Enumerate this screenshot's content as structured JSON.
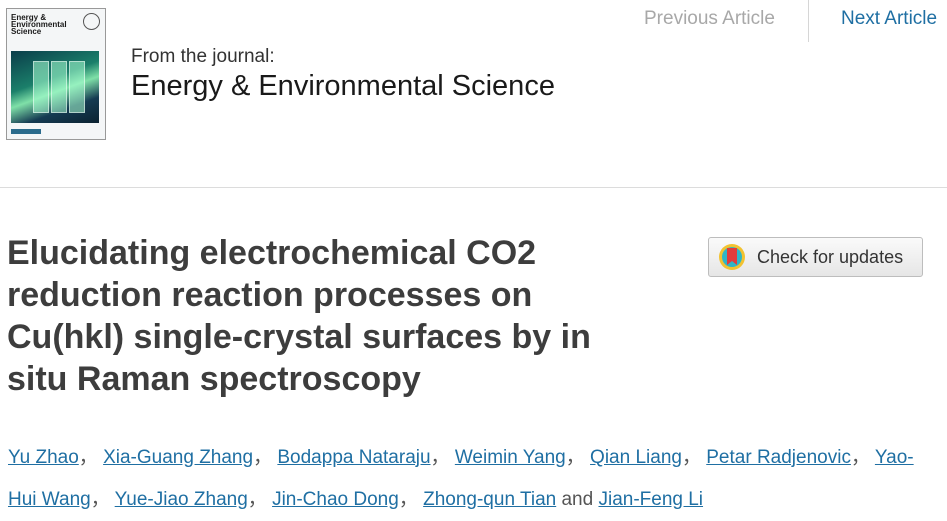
{
  "cover": {
    "title_lines": [
      "Energy &",
      "Environmental",
      "Science"
    ]
  },
  "journal": {
    "from_label": "From the journal:",
    "name": "Energy & Environmental Science"
  },
  "nav": {
    "previous": "Previous Article",
    "next": "Next Article"
  },
  "article": {
    "title": "Elucidating electrochemical CO2 reduction reaction processes on Cu(hkl) single-crystal surfaces by in situ Raman spectroscopy"
  },
  "check_updates": {
    "label": "Check for updates"
  },
  "authors": {
    "list": [
      "Yu Zhao",
      "Xia-Guang Zhang",
      "Bodappa Nataraju",
      "Weimin Yang",
      "Qian Liang",
      "Petar Radjenovic",
      "Yao-Hui Wang",
      "Yue-Jiao Zhang",
      "Jin-Chao Dong",
      "Zhong-qun Tian",
      "Jian-Feng Li"
    ],
    "comma": "，",
    "and": "and"
  },
  "colors": {
    "link": "#1f6fa3",
    "title": "#3d3d3d",
    "nav_disabled": "#a8a8a8"
  }
}
